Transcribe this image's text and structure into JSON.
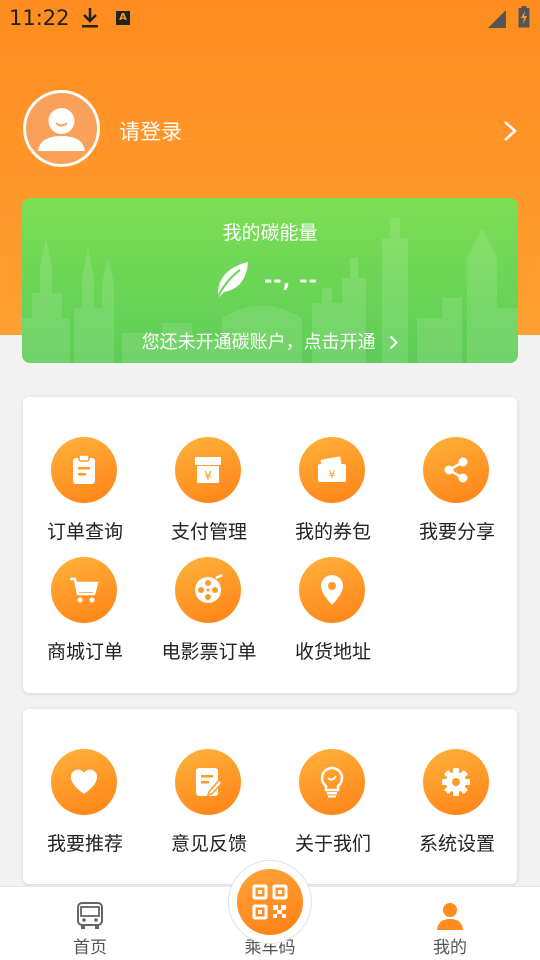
{
  "status_bar": {
    "time": "11:22"
  },
  "profile": {
    "login_label": "请登录"
  },
  "carbon": {
    "title": "我的碳能量",
    "value": "--, --",
    "cta": "您还未开通碳账户，点击开通"
  },
  "panel1": {
    "items": [
      {
        "label": "订单查询",
        "icon": "clipboard-icon"
      },
      {
        "label": "支付管理",
        "icon": "payment-box-icon"
      },
      {
        "label": "我的券包",
        "icon": "coupon-icon"
      },
      {
        "label": "我要分享",
        "icon": "share-icon"
      },
      {
        "label": "商城订单",
        "icon": "shopping-cart-icon"
      },
      {
        "label": "电影票订单",
        "icon": "film-reel-icon"
      },
      {
        "label": "收货地址",
        "icon": "location-pin-icon"
      }
    ]
  },
  "panel2": {
    "items": [
      {
        "label": "我要推荐",
        "icon": "heart-icon"
      },
      {
        "label": "意见反馈",
        "icon": "feedback-icon"
      },
      {
        "label": "关于我们",
        "icon": "lightbulb-icon"
      },
      {
        "label": "系统设置",
        "icon": "gear-icon"
      }
    ]
  },
  "tabs": {
    "home": "首页",
    "ride_code": "乘车码",
    "mine": "我的"
  },
  "colors": {
    "accent": "#ff8c1f",
    "carbon_green": "#6ad655"
  }
}
